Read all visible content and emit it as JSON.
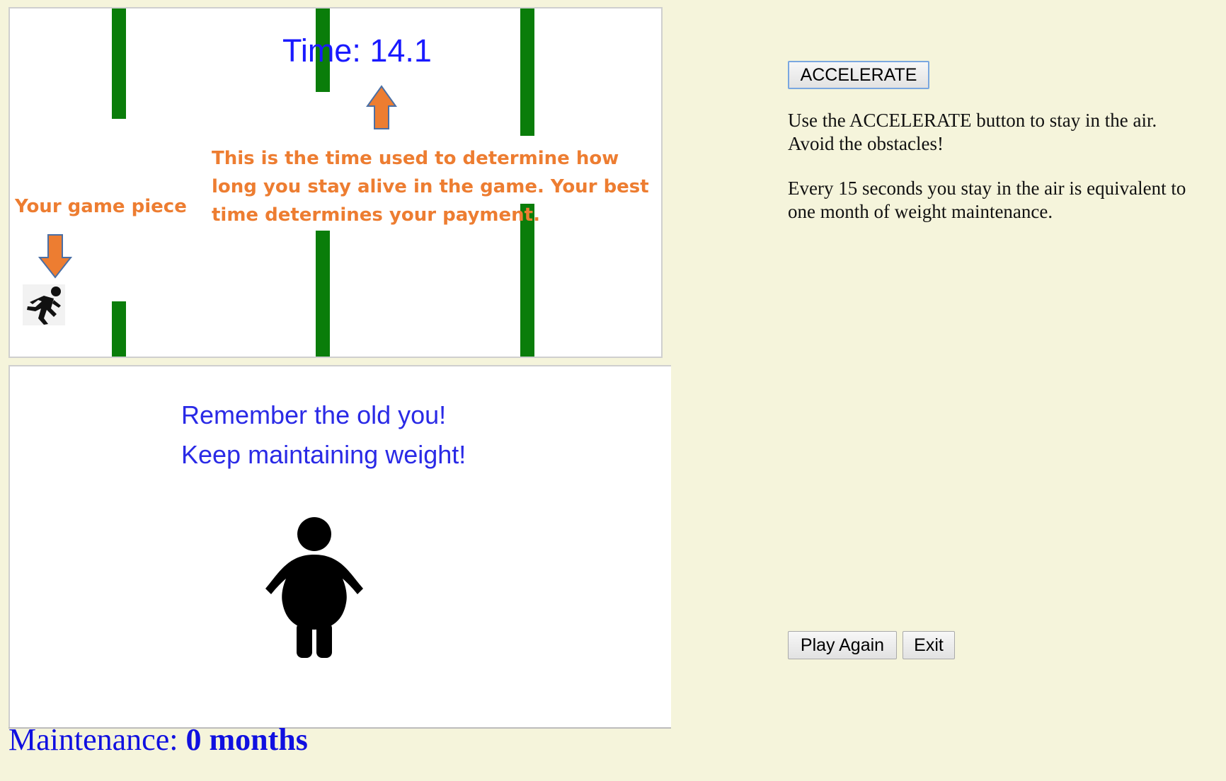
{
  "game": {
    "time_label": "Time: 14.1",
    "annotation_game_piece": "Your game piece",
    "annotation_time_lines": [
      "This is the time used to determine how",
      "long you stay alive in the game.  Your best",
      "time determines your payment."
    ],
    "game_piece_icon": "running-person-icon",
    "obstacle_color": "#0a7d0a",
    "annotation_color": "#ED7D31",
    "time_color": "#1a1aff"
  },
  "message": {
    "line1": "Remember the old you!",
    "line2": "Keep maintaining weight!",
    "figure_icon": "overweight-person-icon"
  },
  "maintenance": {
    "label": "Maintenance:",
    "value": "0 months"
  },
  "controls": {
    "accelerate_label": "ACCELERATE",
    "play_again_label": "Play Again",
    "exit_label": "Exit"
  },
  "instructions": {
    "paragraph1": "Use the ACCELERATE button to stay in the air. Avoid the obstacles!",
    "paragraph2": "Every 15 seconds you stay in the air is equivalent to one month of weight maintenance."
  },
  "colors": {
    "page_background": "#f5f4db",
    "panel_background": "#ffffff",
    "accent_blue": "#1010e0"
  }
}
